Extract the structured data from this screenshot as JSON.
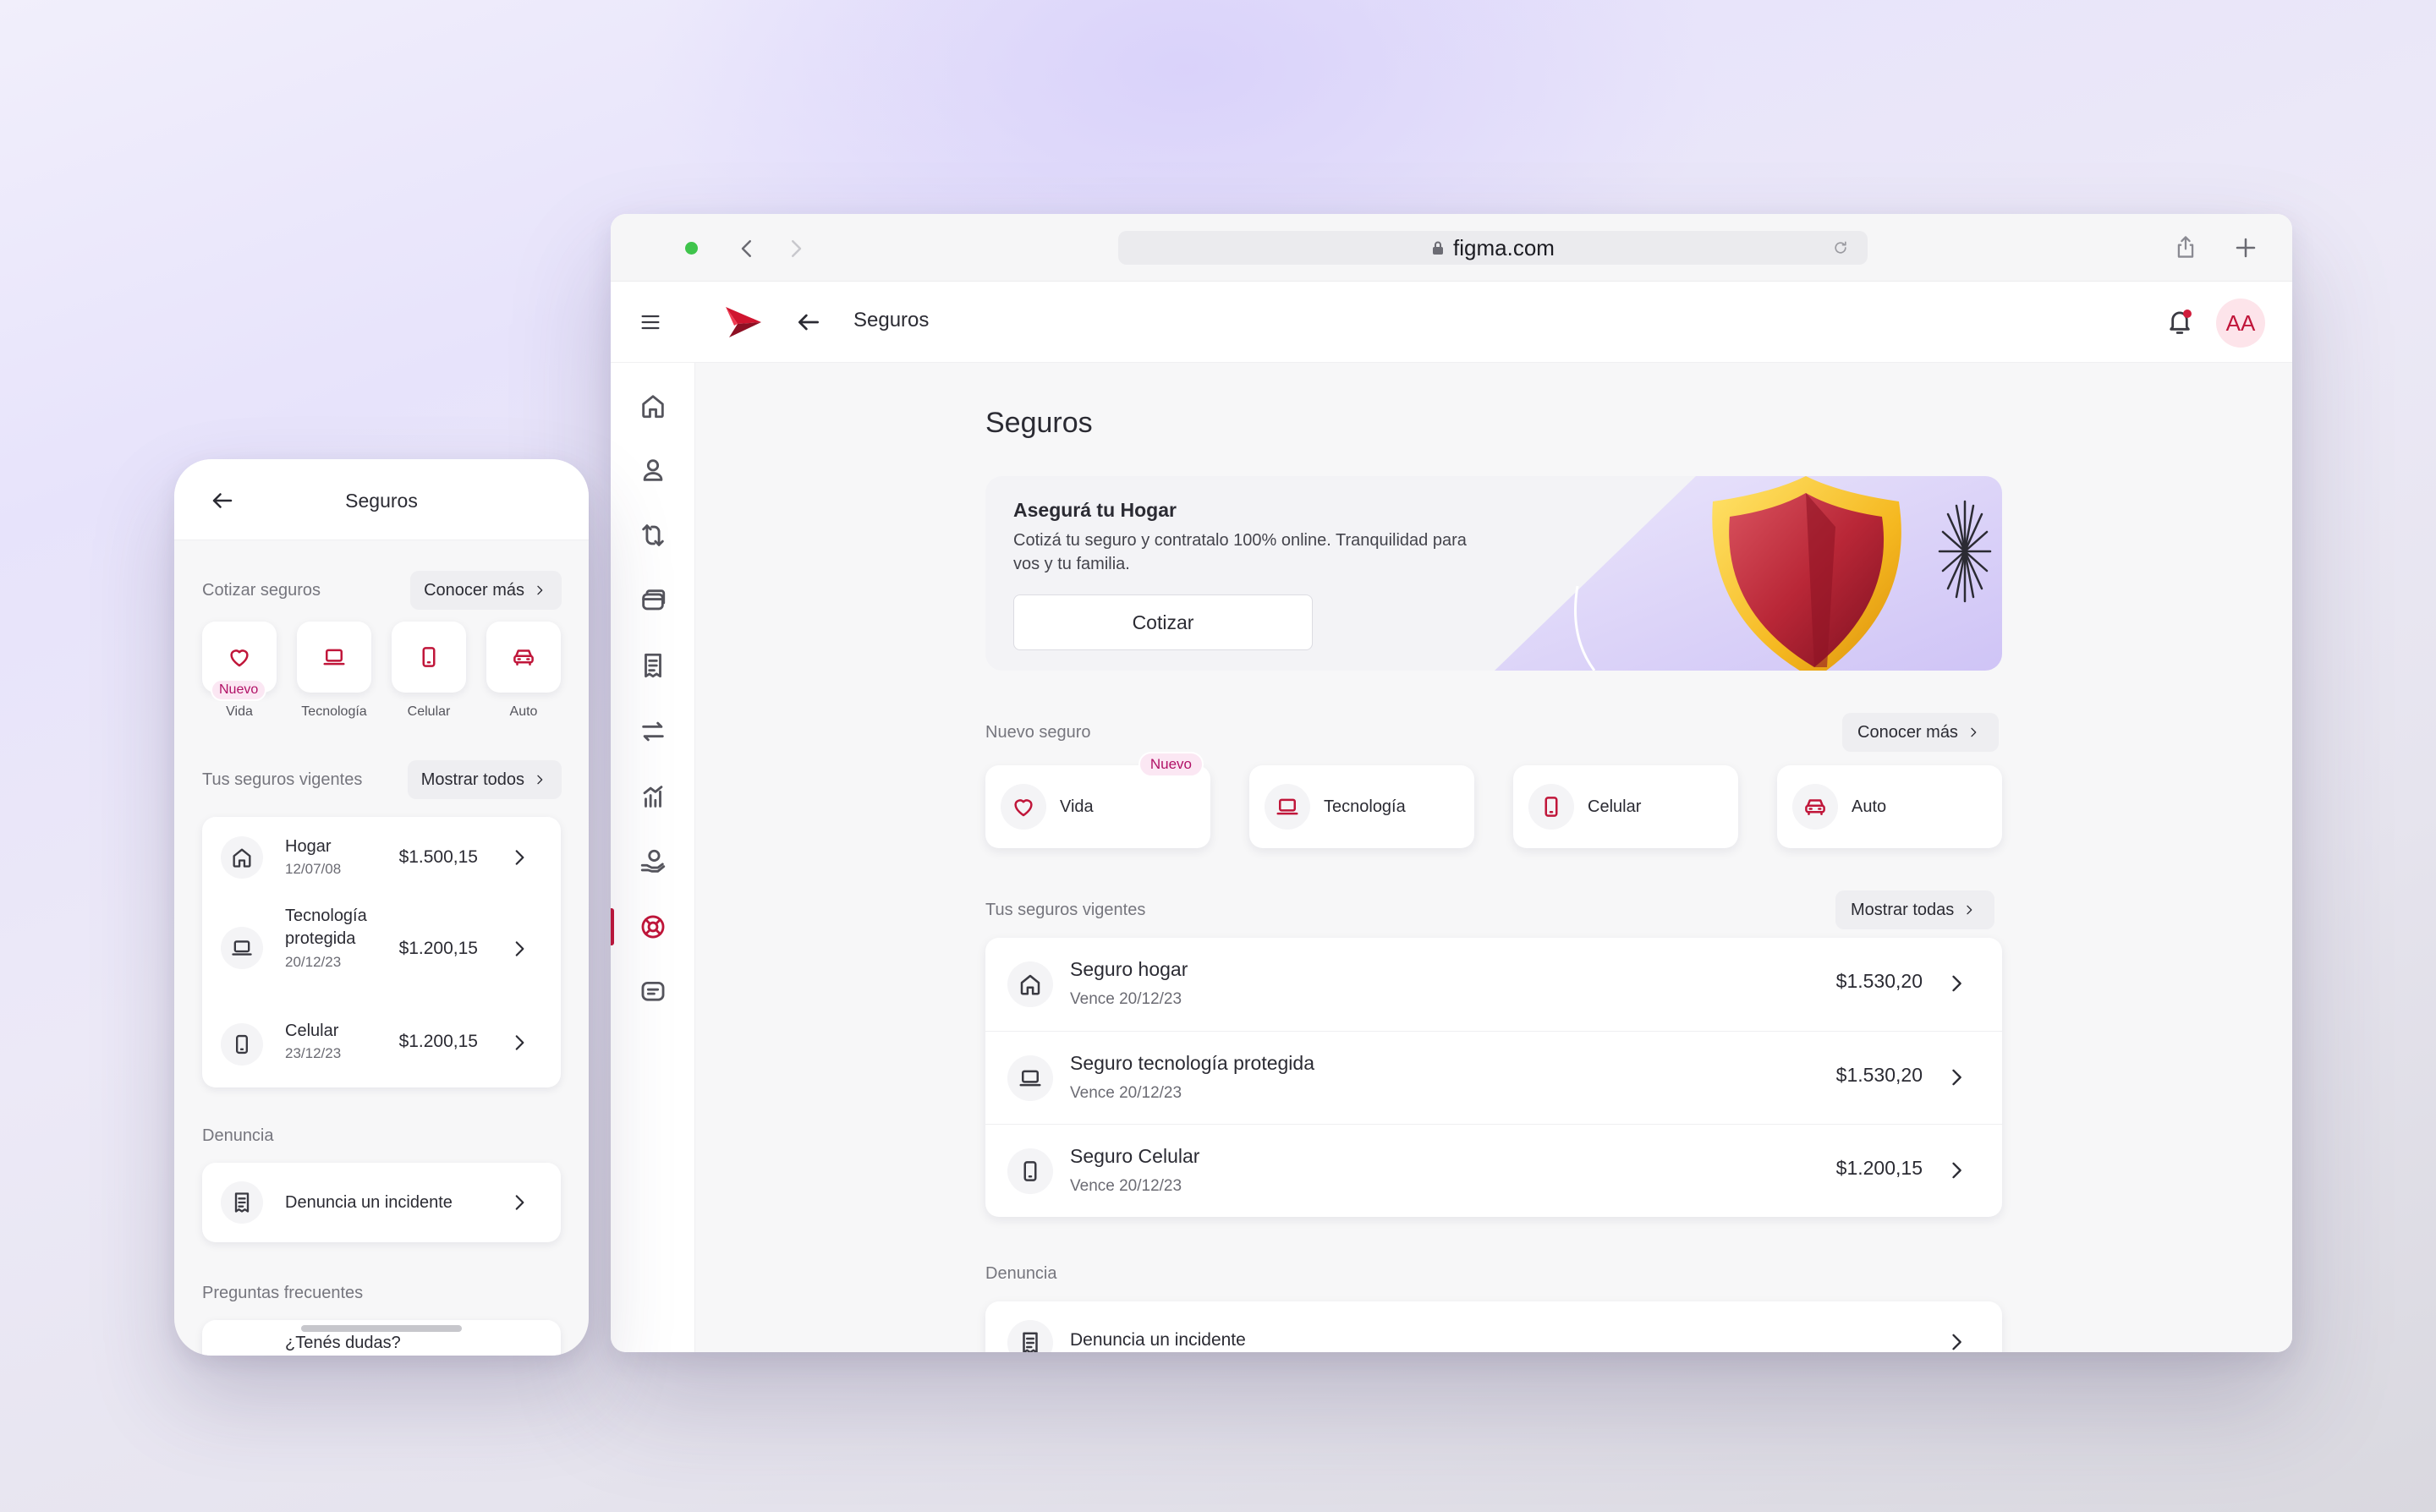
{
  "browser": {
    "url": "figma.com",
    "appbar_title": "Seguros",
    "avatar_initials": "AA",
    "accent_color": "#c0163a"
  },
  "sidebar": {
    "items": [
      {
        "name": "home-icon"
      },
      {
        "name": "user-icon"
      },
      {
        "name": "transfer-cycle-icon"
      },
      {
        "name": "cards-icon"
      },
      {
        "name": "receipt-icon"
      },
      {
        "name": "swap-arrows-icon"
      },
      {
        "name": "chart-icon"
      },
      {
        "name": "hand-coin-icon"
      },
      {
        "name": "lifebuoy-icon",
        "active": true
      },
      {
        "name": "chat-icon"
      }
    ]
  },
  "page": {
    "title": "Seguros",
    "banner": {
      "title": "Asegurá tu Hogar",
      "text": "Cotizá tu seguro y contratalo 100% online. Tranquilidad para vos y tu familia.",
      "button": "Cotizar"
    },
    "nuevo_seguro": {
      "label": "Nuevo seguro",
      "more_button": "Conocer más",
      "badge": "Nuevo",
      "items": [
        {
          "label": "Vida",
          "icon": "heart-icon"
        },
        {
          "label": "Tecnología",
          "icon": "laptop-icon"
        },
        {
          "label": "Celular",
          "icon": "phone-icon"
        },
        {
          "label": "Auto",
          "icon": "car-icon"
        }
      ]
    },
    "vigentes": {
      "label": "Tus seguros vigentes",
      "more_button": "Mostrar todas",
      "rows": [
        {
          "title": "Seguro hogar",
          "sub": "Vence 20/12/23",
          "amount": "$1.530,20",
          "icon": "home-icon"
        },
        {
          "title": "Seguro tecnología protegida",
          "sub": "Vence 20/12/23",
          "amount": "$1.530,20",
          "icon": "laptop-icon"
        },
        {
          "title": "Seguro Celular",
          "sub": "Vence 20/12/23",
          "amount": "$1.200,15",
          "icon": "phone-icon"
        }
      ]
    },
    "denuncia": {
      "label": "Denuncia",
      "row": "Denuncia un incidente"
    }
  },
  "phone": {
    "title": "Seguros",
    "cotizar": {
      "label": "Cotizar seguros",
      "more_button": "Conocer más",
      "badge": "Nuevo",
      "items": [
        {
          "label": "Vida",
          "icon": "heart-icon"
        },
        {
          "label": "Tecnología",
          "icon": "laptop-icon"
        },
        {
          "label": "Celular",
          "icon": "phone-icon"
        },
        {
          "label": "Auto",
          "icon": "car-icon"
        }
      ]
    },
    "vigentes": {
      "label": "Tus seguros vigentes",
      "more_button": "Mostrar todos",
      "rows": [
        {
          "title": "Hogar",
          "sub": "12/07/08",
          "amount": "$1.500,15",
          "icon": "home-icon"
        },
        {
          "title": "Tecnología protegida",
          "sub": "20/12/23",
          "amount": "$1.200,15",
          "icon": "laptop-icon"
        },
        {
          "title": "Celular",
          "sub": "23/12/23",
          "amount": "$1.200,15",
          "icon": "phone-icon"
        }
      ]
    },
    "denuncia": {
      "label": "Denuncia",
      "row": "Denuncia un incidente"
    },
    "faq": {
      "label": "Preguntas frecuentes",
      "first": "¿Tenés dudas?"
    }
  }
}
